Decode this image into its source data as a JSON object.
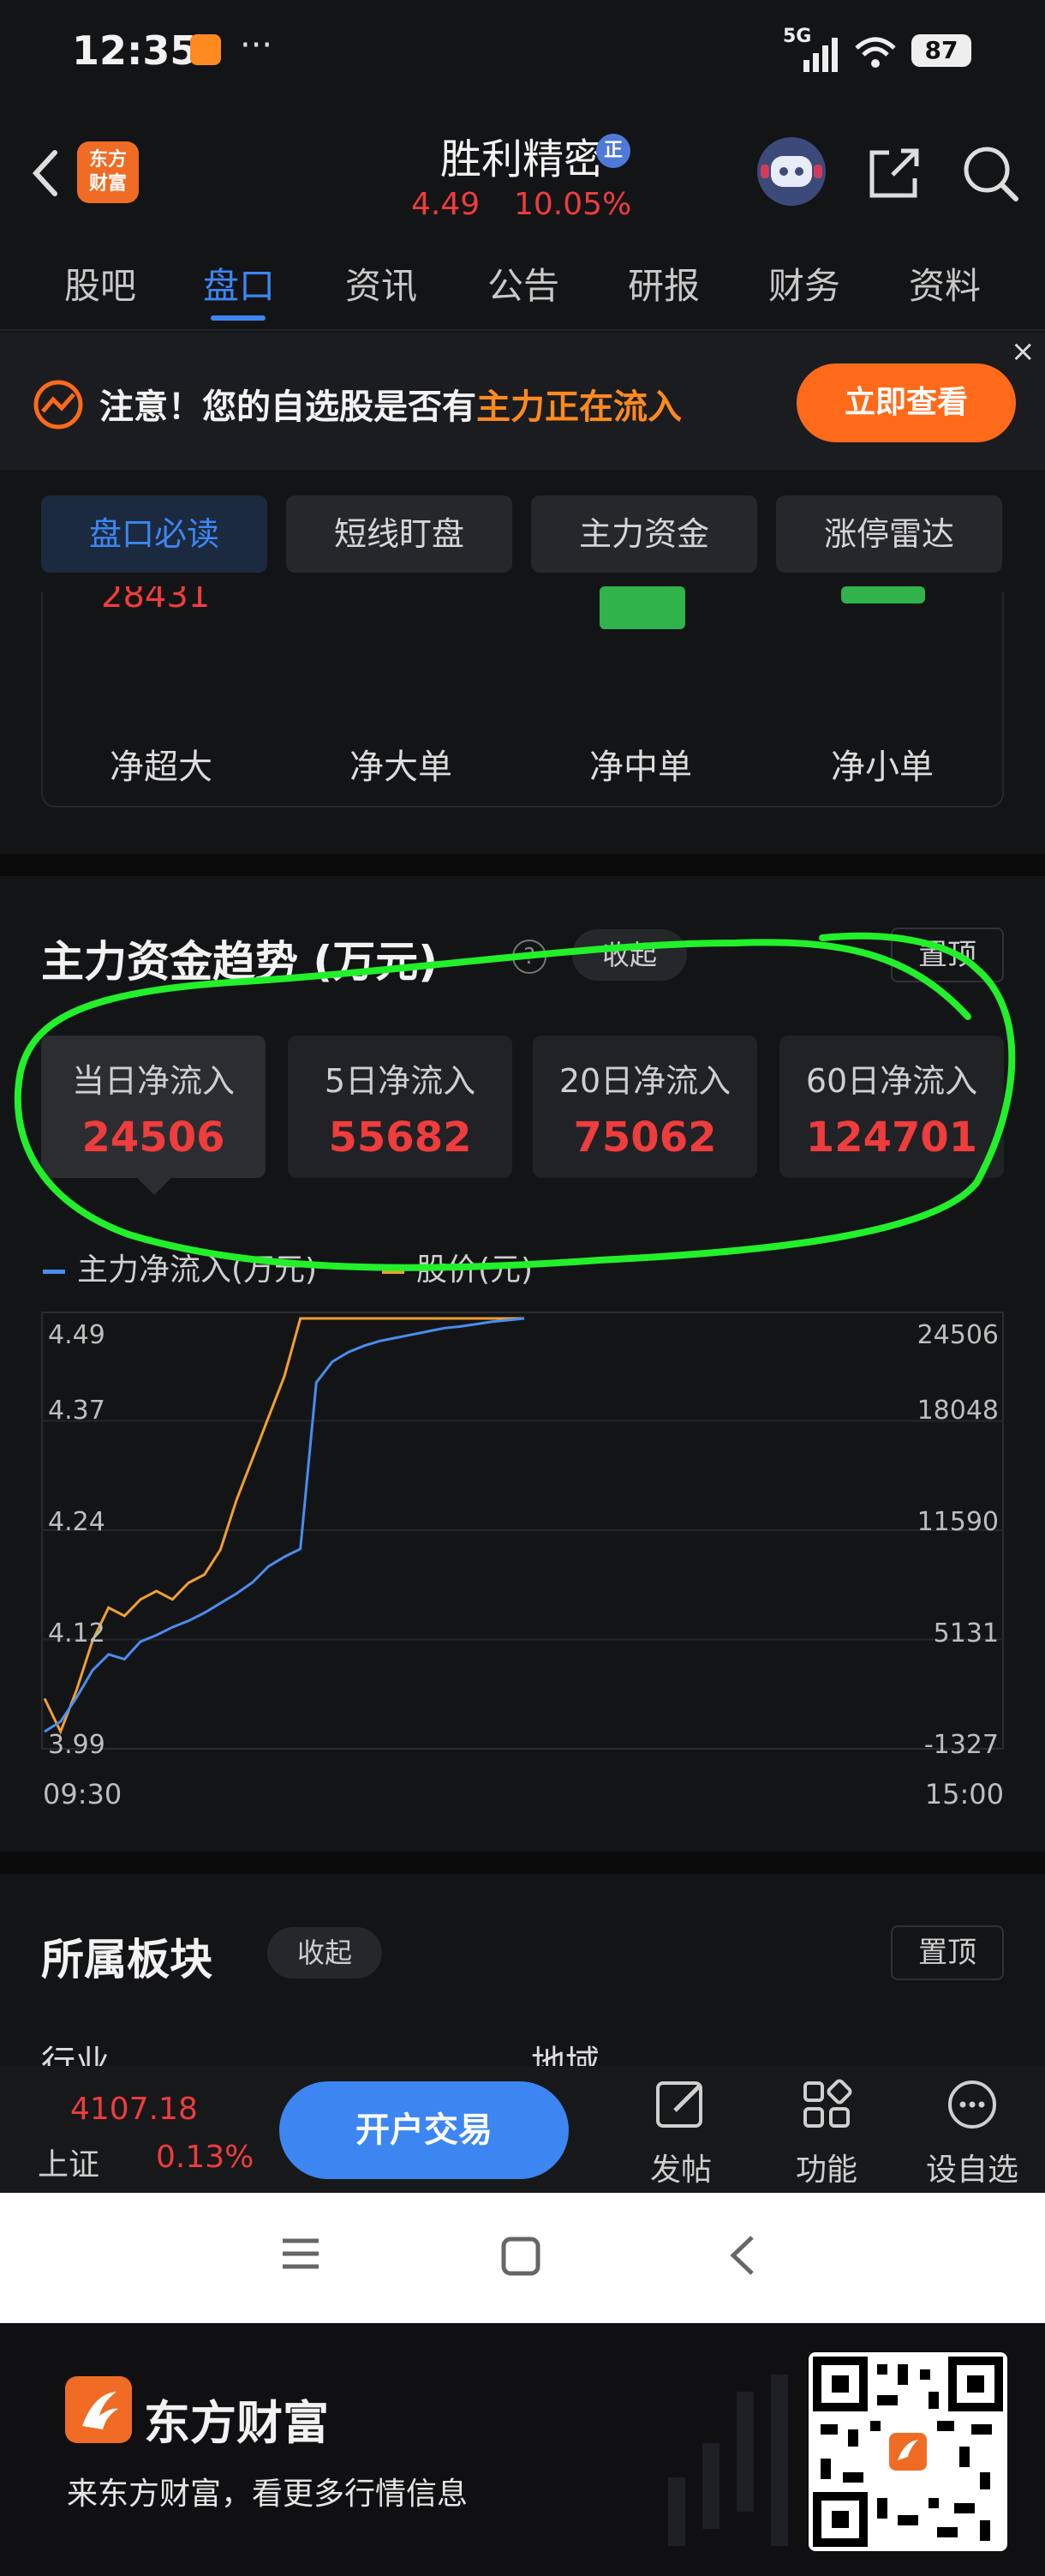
{
  "status": {
    "time": "12:35",
    "dots": "···",
    "network": "5G",
    "battery": "87"
  },
  "header": {
    "logo_text": [
      "东方",
      "财富"
    ],
    "stock_name": "胜利精密",
    "cert": "正",
    "price": "4.49",
    "change_pct": "10.05%"
  },
  "tabs": [
    "股吧",
    "盘口",
    "资讯",
    "公告",
    "研报",
    "财务",
    "资料"
  ],
  "active_tab": "盘口",
  "notice": {
    "prefix": "注意！您的自选股是否有",
    "highlight": "主力正在流入",
    "button": "立即查看",
    "close": "×"
  },
  "subtabs": [
    "盘口必读",
    "短线盯盘",
    "主力资金",
    "涨停雷达"
  ],
  "flow_summary": {
    "partial_value": "28431",
    "labels": [
      "净超大",
      "净大单",
      "净中单",
      "净小单"
    ]
  },
  "trend": {
    "title": "主力资金趋势 (万元)",
    "help": "?",
    "collapse": "收起",
    "pin": "置顶",
    "periods": [
      {
        "label": "当日净流入",
        "value": "24506"
      },
      {
        "label": "5日净流入",
        "value": "55682"
      },
      {
        "label": "20日净流入",
        "value": "75062"
      },
      {
        "label": "60日净流入",
        "value": "124701"
      }
    ],
    "legend_flow": "主力净流入(万元)",
    "legend_price": "股价(元)",
    "color_flow": "#4a8cf0",
    "color_price": "#f0a030"
  },
  "chart_data": {
    "type": "line",
    "x_start": "09:30",
    "x_end": "15:00",
    "y_left_ticks": [
      "4.49",
      "4.37",
      "4.24",
      "4.12",
      "3.99"
    ],
    "y_right_ticks": [
      "24506",
      "18048",
      "11590",
      "5131",
      "-1327"
    ],
    "ylim_price": [
      3.99,
      4.49
    ],
    "ylim_flow": [
      -1327,
      24506
    ],
    "series": [
      {
        "name": "主力净流入(万元)",
        "values": [
          -1327,
          -700,
          800,
          2500,
          3500,
          3200,
          4300,
          4700,
          5200,
          5600,
          6100,
          6700,
          7300,
          8000,
          9000,
          9600,
          10100,
          20500,
          21800,
          22400,
          22800,
          23100,
          23300,
          23500,
          23700,
          23900,
          24000,
          24150,
          24300,
          24400,
          24506
        ]
      },
      {
        "name": "股价(元)",
        "values": [
          4.03,
          3.99,
          4.04,
          4.1,
          4.14,
          4.13,
          4.15,
          4.16,
          4.15,
          4.17,
          4.18,
          4.21,
          4.27,
          4.32,
          4.37,
          4.42,
          4.49,
          4.49,
          4.49,
          4.49,
          4.49,
          4.49,
          4.49,
          4.49,
          4.49,
          4.49,
          4.49,
          4.49,
          4.49,
          4.49,
          4.49
        ]
      }
    ]
  },
  "sector": {
    "title": "所属板块",
    "collapse": "收起",
    "pin": "置顶",
    "col1": "行业",
    "col2": "地域"
  },
  "bottombar": {
    "index_value": "4107.18",
    "index_name": "上证",
    "index_pct": "0.13%",
    "open_button": "开户交易",
    "items": [
      "发帖",
      "功能",
      "设自选"
    ]
  },
  "footer": {
    "brand": "东方财富",
    "slogan": "来东方财富，看更多行情信息"
  }
}
